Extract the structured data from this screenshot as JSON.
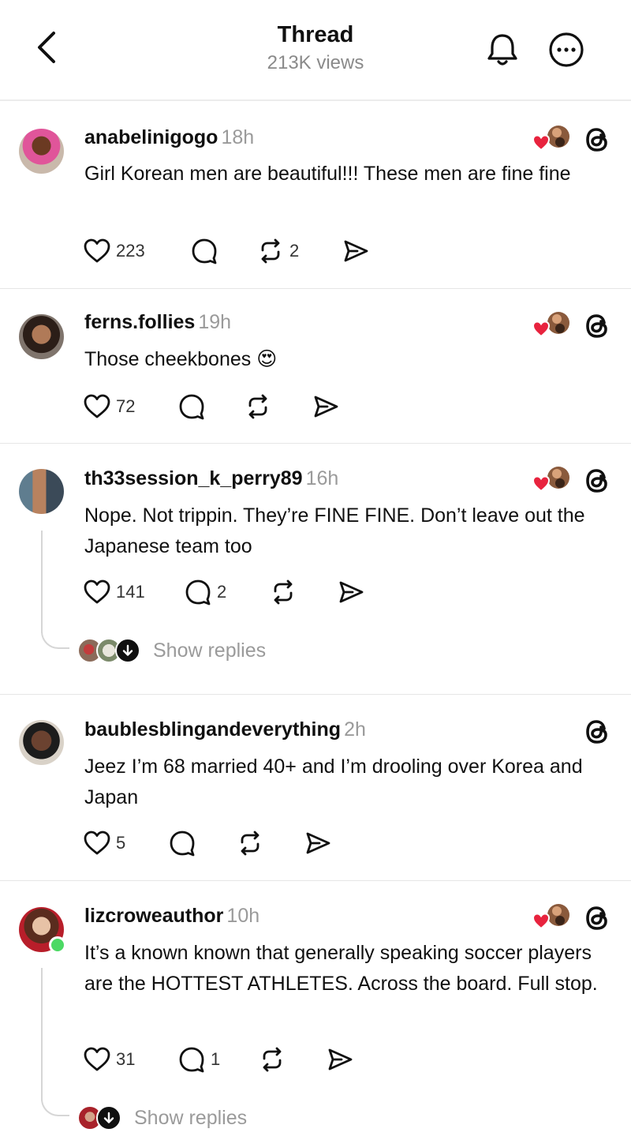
{
  "header": {
    "title": "Thread",
    "views": "213K views"
  },
  "icons": {
    "back": "chevron-left-icon",
    "bell": "bell-icon",
    "more": "more-horizontal-icon",
    "like": "heart-icon",
    "comment": "comment-icon",
    "repost": "repost-icon",
    "share": "send-icon",
    "threads": "threads-logo-icon"
  },
  "colors": {
    "heart": "#e8233e",
    "muted": "#9a9a9a",
    "online": "#4cd964"
  },
  "posts": [
    {
      "username": "anabelinigogo",
      "time": "18h",
      "text": "Girl Korean men are beautiful!!! These men are fine fine",
      "likes": "223",
      "replies": "",
      "reposts": "2"
    },
    {
      "username": "ferns.follies",
      "time": "19h",
      "text": "Those cheekbones 😍",
      "likes": "72",
      "replies": "",
      "reposts": ""
    },
    {
      "username": "th33session_k_perry89",
      "time": "16h",
      "text": "Nope. Not trippin. They’re FINE FINE. Don’t leave out the Japanese team too",
      "likes": "141",
      "replies": "2",
      "reposts": "",
      "show_replies": "Show replies"
    },
    {
      "username": "baublesblingandeverything",
      "time": "2h",
      "text": "Jeez I’m 68 married 40+ and I’m drooling over Korea and Japan",
      "likes": "5",
      "replies": "",
      "reposts": ""
    },
    {
      "username": "lizcroweauthor",
      "time": "10h",
      "text": "It’s a known known  that generally speaking soccer players are the HOTTEST ATHLETES.  Across the board. Full stop.",
      "likes": "31",
      "replies": "1",
      "reposts": "",
      "show_replies": "Show replies"
    }
  ]
}
